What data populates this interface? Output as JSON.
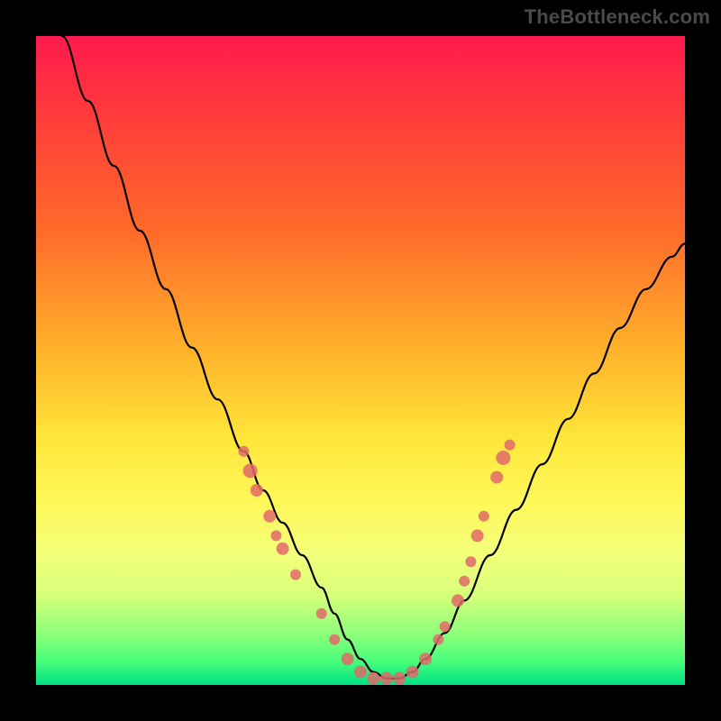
{
  "watermark": "TheBottleneck.com",
  "colors": {
    "frame": "#000000",
    "dot": "#e06a6a",
    "curve": "#000000",
    "gradient_top": "#ff1a4d",
    "gradient_bottom": "#00e383"
  },
  "chart_data": {
    "type": "line",
    "title": "",
    "xlabel": "",
    "ylabel": "",
    "xlim": [
      0,
      100
    ],
    "ylim": [
      0,
      100
    ],
    "grid": false,
    "legend": false,
    "series": [
      {
        "name": "bottleneck-curve",
        "x": [
          4,
          8,
          12,
          16,
          20,
          24,
          28,
          32,
          35,
          38,
          41,
          44,
          46,
          48,
          50,
          52,
          54,
          56,
          58,
          60,
          63,
          66,
          70,
          74,
          78,
          82,
          86,
          90,
          94,
          98,
          100
        ],
        "y": [
          100,
          90,
          80,
          70,
          61,
          52,
          44,
          36,
          30,
          25,
          20,
          15,
          11,
          7,
          4,
          2,
          1,
          1,
          2,
          4,
          8,
          13,
          20,
          27,
          34,
          41,
          48,
          55,
          61,
          66,
          68
        ]
      }
    ],
    "scatter": {
      "name": "marker-dots",
      "points": [
        {
          "x": 32,
          "y": 36,
          "r": 6
        },
        {
          "x": 33,
          "y": 33,
          "r": 8
        },
        {
          "x": 34,
          "y": 30,
          "r": 7
        },
        {
          "x": 36,
          "y": 26,
          "r": 7
        },
        {
          "x": 37,
          "y": 23,
          "r": 6
        },
        {
          "x": 38,
          "y": 21,
          "r": 7
        },
        {
          "x": 40,
          "y": 17,
          "r": 6
        },
        {
          "x": 44,
          "y": 11,
          "r": 6
        },
        {
          "x": 46,
          "y": 7,
          "r": 6
        },
        {
          "x": 48,
          "y": 4,
          "r": 7
        },
        {
          "x": 50,
          "y": 2,
          "r": 7
        },
        {
          "x": 52,
          "y": 1,
          "r": 7
        },
        {
          "x": 54,
          "y": 1,
          "r": 7
        },
        {
          "x": 56,
          "y": 1,
          "r": 7
        },
        {
          "x": 58,
          "y": 2,
          "r": 7
        },
        {
          "x": 60,
          "y": 4,
          "r": 7
        },
        {
          "x": 62,
          "y": 7,
          "r": 6
        },
        {
          "x": 63,
          "y": 9,
          "r": 6
        },
        {
          "x": 65,
          "y": 13,
          "r": 7
        },
        {
          "x": 66,
          "y": 16,
          "r": 6
        },
        {
          "x": 67,
          "y": 19,
          "r": 6
        },
        {
          "x": 68,
          "y": 23,
          "r": 7
        },
        {
          "x": 69,
          "y": 26,
          "r": 6
        },
        {
          "x": 71,
          "y": 32,
          "r": 7
        },
        {
          "x": 72,
          "y": 35,
          "r": 8
        },
        {
          "x": 73,
          "y": 37,
          "r": 6
        }
      ]
    }
  }
}
